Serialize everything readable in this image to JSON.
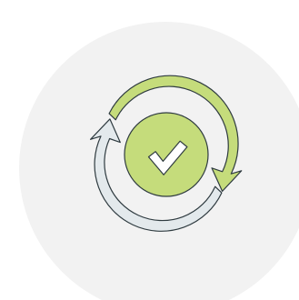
{
  "illustration": {
    "icon": "sync-check-icon",
    "colors": {
      "page_background": "#ffffff",
      "backdrop_circle": "#f2f2f2",
      "green_arrow": "#c5dc7b",
      "gray_arrow": "#e3e9ec",
      "check_badge": "#c5dc7b",
      "checkmark": "#ffffff",
      "outline": "#2f3b40"
    }
  }
}
